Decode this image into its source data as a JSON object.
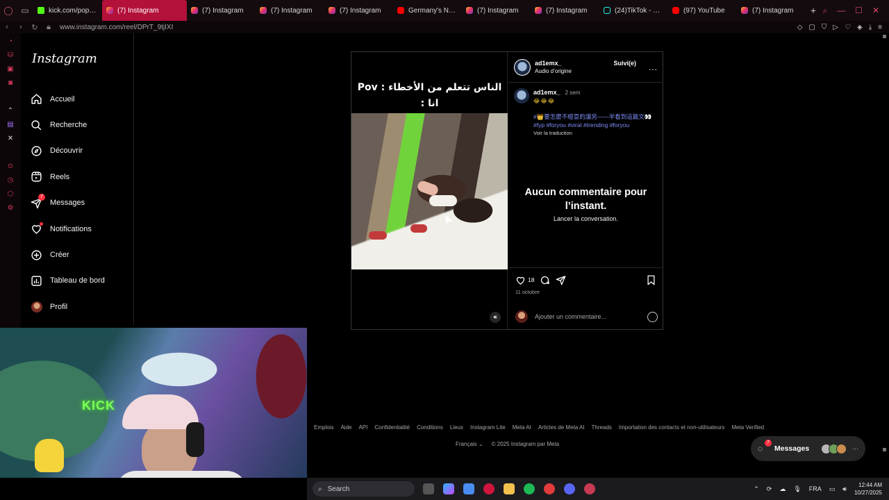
{
  "browser": {
    "tabs": [
      {
        "label": "kick.com/popout/",
        "favicon": "kick",
        "active": false
      },
      {
        "label": "(7) Instagram",
        "favicon": "instagram",
        "active": true
      },
      {
        "label": "(7) Instagram",
        "favicon": "instagram",
        "active": false
      },
      {
        "label": "(7) Instagram",
        "favicon": "instagram",
        "active": false
      },
      {
        "label": "(7) Instagram",
        "favicon": "instagram",
        "active": false
      },
      {
        "label": "Germany's Next T",
        "favicon": "youtube",
        "active": false
      },
      {
        "label": "(7) Instagram",
        "favicon": "instagram",
        "active": false
      },
      {
        "label": "(7) Instagram",
        "favicon": "instagram",
        "active": false
      },
      {
        "label": "(24)TikTok - Mak",
        "favicon": "tiktok",
        "active": false
      },
      {
        "label": "(97) YouTube",
        "favicon": "youtube",
        "active": false
      },
      {
        "label": "(7) Instagram",
        "favicon": "instagram",
        "active": false
      }
    ],
    "url": "www.instagram.com/reel/DPrT_9tjIXI",
    "accent_color": "#b3113a"
  },
  "instagram": {
    "logo": "Instagram",
    "nav": [
      {
        "label": "Accueil",
        "icon": "home-icon"
      },
      {
        "label": "Recherche",
        "icon": "search-icon"
      },
      {
        "label": "Découvrir",
        "icon": "compass-icon"
      },
      {
        "label": "Reels",
        "icon": "reels-icon"
      },
      {
        "label": "Messages",
        "icon": "messenger-icon",
        "badge": "7"
      },
      {
        "label": "Notifications",
        "icon": "heart-icon"
      },
      {
        "label": "Créer",
        "icon": "plus-icon"
      },
      {
        "label": "Tableau de bord",
        "icon": "dashboard-icon"
      },
      {
        "label": "Profil",
        "icon": "avatar"
      }
    ]
  },
  "post": {
    "overlay_text_line1": "الناس تتعلم من الأخطاء : Pov",
    "overlay_text_line2": "انا :",
    "author": "ad1emx_",
    "audio": "Audio d’origine",
    "follow_status": "Suivi(e)",
    "more": "...",
    "caption_user": "ad1emx_",
    "caption_time": "2 sem",
    "caption_emojis": "😂😂😂",
    "caption_text": "#👑要怎麼不經意的讓另——半看到這篇文👀",
    "hashtags": [
      "#fyp",
      "#foryou",
      "#viral",
      "#trending",
      "#foryou"
    ],
    "see_translation": "Voir la traduction",
    "no_comments_title": "Aucun commentaire pour l’instant.",
    "no_comments_sub": "Lancer la conversation.",
    "likes": "18",
    "date": "11 octobre",
    "comment_placeholder": "Ajouter un commentaire..."
  },
  "footer": {
    "links": [
      "Emplois",
      "Aide",
      "API",
      "Confidentialité",
      "Conditions",
      "Lieux",
      "Instagram Lite",
      "Meta AI",
      "Articles de Meta AI",
      "Threads",
      "Importation des contacts et non-utilisateurs",
      "Meta Verified"
    ],
    "language": "Français",
    "copyright": "© 2025 Instagram par Meta"
  },
  "messages_pill": {
    "label": "Messages",
    "badge": "7"
  },
  "webcam": {
    "sign": "KICK"
  },
  "taskbar": {
    "search": "Search",
    "language": "FRA",
    "time": "12:44 AM",
    "date": "10/27/2025"
  }
}
